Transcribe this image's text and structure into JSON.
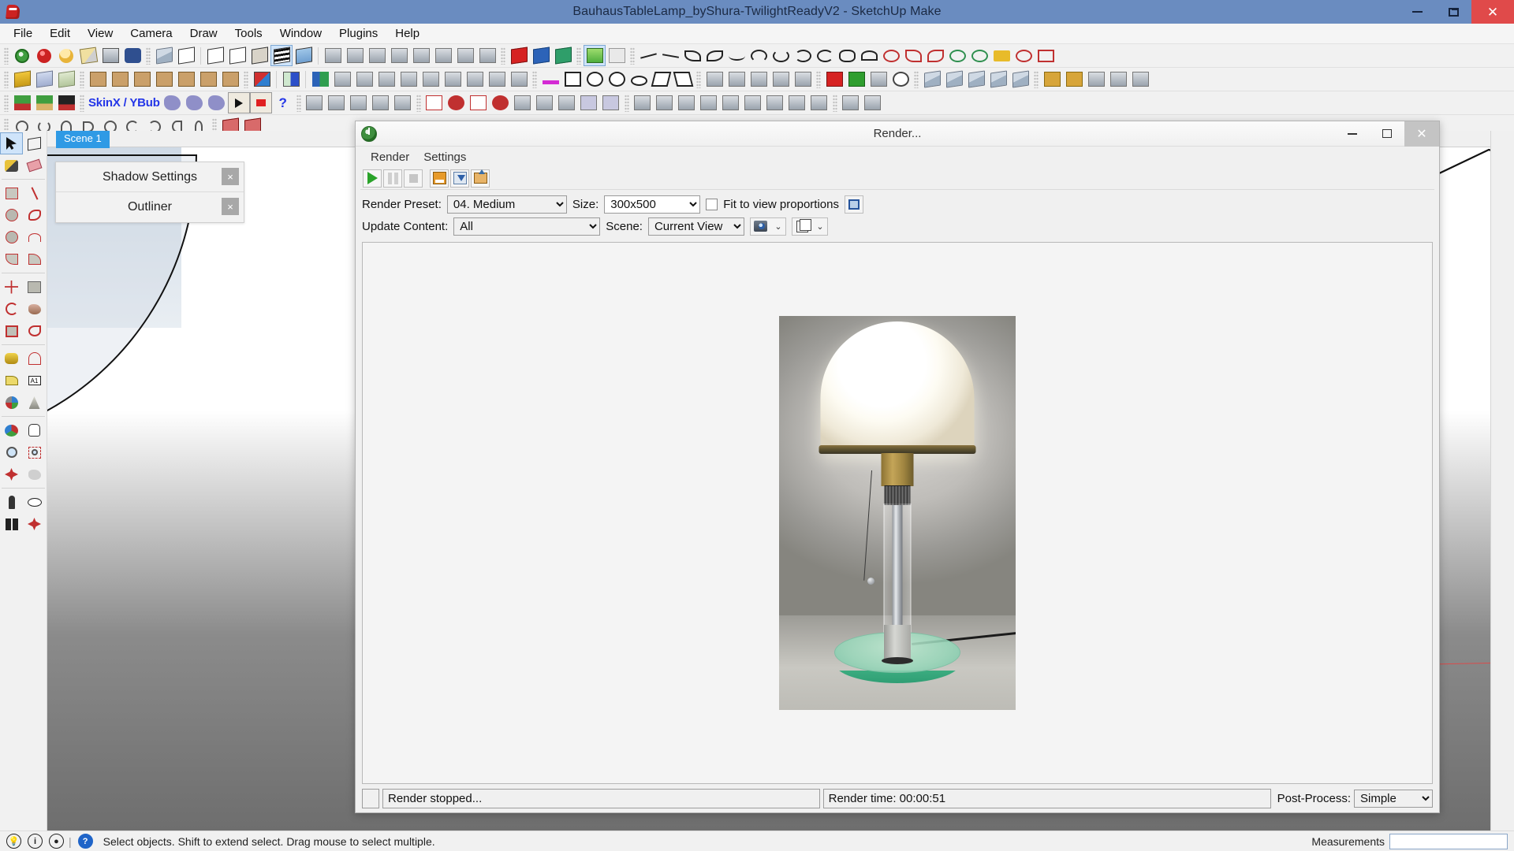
{
  "window": {
    "title": "BauhausTableLamp_byShura-TwilightReadyV2 - SketchUp Make",
    "app_icon": "sketchup-logo-icon",
    "controls": {
      "minimize": "minimize-icon",
      "maximize": "maximize-icon",
      "close": "close-icon"
    }
  },
  "menubar": {
    "items": [
      "File",
      "Edit",
      "View",
      "Camera",
      "Draw",
      "Tools",
      "Window",
      "Plugins",
      "Help"
    ]
  },
  "toolbars": {
    "row1_groups": [
      [
        "power-icon",
        "compass-icon",
        "sun-icon",
        "materials-icon",
        "texture-icon",
        "binoculars-icon"
      ],
      [
        "solid-tools-icon",
        "outer-shell-icon"
      ],
      [
        "style-wireframe-icon",
        "style-hidden-line-icon",
        "style-shaded-icon",
        "style-shaded-texture-icon",
        "style-monochrome-icon"
      ],
      [
        "section-plane-icon",
        "section-display-icon",
        "section-cut-icon"
      ],
      [
        "render-icon",
        "render-settings-icon",
        "render-export-icon"
      ],
      [
        "image-icon",
        "select-pointer-icon"
      ],
      [
        "curve-tool-1-icon",
        "curve-tool-2-icon",
        "curve-tool-3-icon",
        "curve-tool-4-icon",
        "curve-tool-5-icon"
      ],
      [
        "arc-1-icon",
        "arc-2-icon",
        "arc-3-icon",
        "arc-4-icon",
        "arc-5-icon",
        "arc-6-icon"
      ],
      [
        "bezier-1-icon",
        "bezier-2-icon",
        "bezier-3-icon"
      ],
      [
        "weld-icon",
        "circle-icon",
        "lock-icon",
        "face-icon",
        "extra-icon"
      ]
    ],
    "row2_groups": [
      [
        "iso-view-icon",
        "top-view-icon",
        "front-view-icon"
      ],
      [
        "extrude-icon",
        "extrude-j-icon",
        "extrude-r-icon",
        "extrude-v-icon",
        "extrude-n-icon",
        "extrude-x-icon",
        "extrude-f-icon"
      ],
      [
        "color-face-icon",
        "shape-bender-icon",
        "flip-icon"
      ],
      [
        "scale-icon",
        "mirror-icon",
        "rotate-icon",
        "move-icon"
      ],
      [
        "component-icon",
        "group-icon",
        "dynamic-icon"
      ],
      [
        "rect-icon",
        "circle2-icon",
        "polygon-icon",
        "ellipse-icon",
        "freehand-icon",
        "line-icon"
      ],
      [
        "sandbox-1-icon",
        "sandbox-2-icon",
        "sandbox-3-icon",
        "sandbox-4-icon",
        "sandbox-5-icon"
      ],
      [
        "profile-builder-icon",
        "profile-place-icon",
        "profile-edit-icon"
      ],
      [
        "clock-icon",
        "layers-icon"
      ],
      [
        "fredo-1-icon",
        "fredo-2-icon",
        "fredo-3-icon",
        "fredo-4-icon",
        "fredo-5-icon"
      ],
      [
        "tag-icon",
        "tag2-icon",
        "unit-icon",
        "dim-icon",
        "box-icon"
      ]
    ],
    "row3_groups": [
      [
        "plant-1-icon",
        "plant-2-icon",
        "legs-icon"
      ],
      [
        "skinx-label",
        "skin-1-icon",
        "skin-2-icon",
        "skin-3-icon",
        "play-icon",
        "stop-icon",
        "help-icon"
      ],
      [
        "house-icon",
        "roof-1-icon",
        "roof-2-icon",
        "roof-3-icon"
      ],
      [
        "tools-on-surface-1-icon",
        "tools-on-surface-2-icon",
        "tools-on-surface-3-icon",
        "tools-on-surface-4-icon"
      ],
      [
        "joint-push-pull-1-icon",
        "joint-push-pull-2-icon",
        "joint-push-pull-3-icon"
      ],
      [
        "curviloft-1-icon",
        "curviloft-2-icon"
      ],
      [
        "misc-1-icon",
        "misc-2-icon",
        "misc-3-icon",
        "misc-4-icon",
        "misc-5-icon"
      ],
      [
        "round-corner-icon",
        "visuhole-icon"
      ]
    ],
    "row4_groups": [
      [
        "spiral-1-icon",
        "spiral-2-icon",
        "spiral-3-icon",
        "spiral-4-icon",
        "spiral-5-icon",
        "spiral-6-icon",
        "spiral-7-icon",
        "spiral-8-icon",
        "spiral-9-icon"
      ],
      [
        "comp-red-1-icon",
        "comp-red-2-icon"
      ]
    ],
    "skinx_label": "SkinX / YBub"
  },
  "left_palette": {
    "tools": [
      "select-arrow-icon",
      "make-component-icon",
      "paint-bucket-icon",
      "eraser-icon",
      "rectangle-icon",
      "line-icon",
      "circle-icon",
      "freehand-icon",
      "polygon-icon",
      "arc-icon",
      "pie-icon",
      "two-point-arc-icon",
      "move-icon",
      "push-pull-icon",
      "rotate-icon",
      "follow-me-icon",
      "scale-icon",
      "offset-icon",
      "tape-measure-icon",
      "protractor-icon",
      "dimension-icon",
      "text-icon",
      "axes-icon",
      "3d-text-icon",
      "orbit-icon",
      "pan-icon",
      "zoom-icon",
      "zoom-window-icon",
      "zoom-extents-icon",
      "previous-view-icon",
      "position-camera-icon",
      "look-around-icon",
      "walk-icon",
      "section-plane-icon"
    ],
    "active_tool": "select-arrow-icon"
  },
  "viewport": {
    "scene_tab": "Scene 1",
    "trays": [
      {
        "title": "Shadow Settings",
        "close": "×"
      },
      {
        "title": "Outliner",
        "close": "×"
      }
    ]
  },
  "render_dialog": {
    "title": "Render...",
    "icon": "twilight-render-icon",
    "controls": {
      "minimize": "minimize-icon",
      "maximize": "maximize-icon",
      "close": "close-icon"
    },
    "menu": [
      "Render",
      "Settings"
    ],
    "toolbar_buttons": [
      "start-render-icon",
      "pause-render-icon",
      "stop-render-icon",
      "save-image-icon",
      "save-image-as-icon",
      "export-icon"
    ],
    "options": {
      "preset_label": "Render Preset:",
      "preset_value": "04. Medium",
      "size_label": "Size:",
      "size_value": "300x500",
      "fit_label": "Fit to view proportions",
      "fit_checked": false,
      "crop_button": "crop-region-icon",
      "update_label": "Update Content:",
      "update_value": "All",
      "scene_label": "Scene:",
      "scene_value": "Current View",
      "camera_button": "camera-icon",
      "pages_button": "pages-icon"
    },
    "status": {
      "message": "Render stopped...",
      "time": "Render time: 00:00:51",
      "postprocess_label": "Post-Process:",
      "postprocess_value": "Simple"
    },
    "image": {
      "alt": "Bauhaus table lamp render",
      "width": "300",
      "height": "500"
    }
  },
  "statusbar": {
    "icons": [
      "tips-icon",
      "info-icon",
      "account-icon",
      "help-icon"
    ],
    "message": "Select objects. Shift to extend select. Drag mouse to select multiple.",
    "measurements_label": "Measurements",
    "measurements_value": ""
  },
  "colors": {
    "titlebar": "#6a8cc0",
    "close_button": "#e04a4a",
    "scene_tab": "#2f9ae5",
    "accent_selected": "#cfe4fa",
    "render_play": "#2aa32a"
  }
}
